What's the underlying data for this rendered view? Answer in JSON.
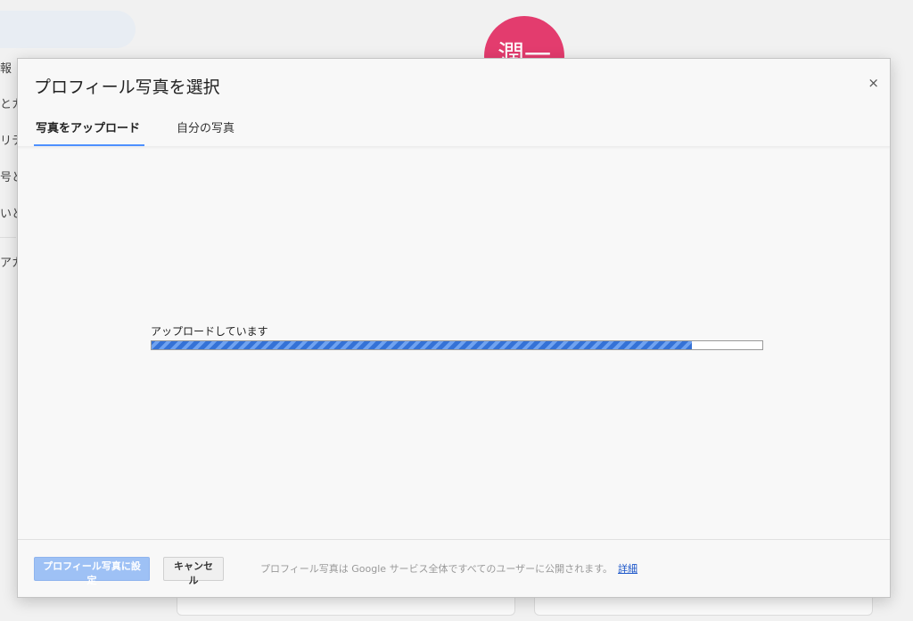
{
  "background": {
    "avatar_text": "潤一",
    "side_snippets": [
      "報",
      "とカ",
      "リテ",
      "号と",
      "いと",
      "アカ"
    ],
    "colors": {
      "avatar": "#e33c6e"
    }
  },
  "dialog": {
    "title": "プロフィール写真を選択",
    "close_icon": "close-icon",
    "close_label": "×",
    "tabs": [
      {
        "label": "写真をアップロード",
        "active": true
      },
      {
        "label": "自分の写真",
        "active": false
      }
    ],
    "upload": {
      "status_text": "アップロードしています",
      "progress_fraction": 0.885
    },
    "footer": {
      "set_button_label": "プロフィール写真に設定",
      "cancel_button_label": "キャンセル",
      "note_text": "プロフィール写真は Google サービス全体ですべてのユーザーに公開されます。",
      "details_link_label": "詳細"
    },
    "colors": {
      "accent": "#4d90fe",
      "primary_button_disabled": "#9ec1f5",
      "progress_bar": "#3f7fe6",
      "link": "#1a55c9"
    }
  }
}
